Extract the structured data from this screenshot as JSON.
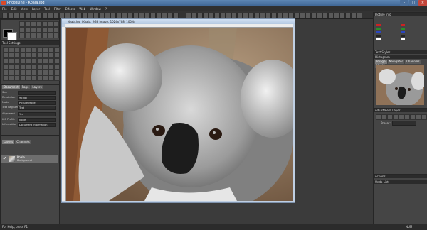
{
  "window": {
    "title": "PhotoLine - Koala.jpg"
  },
  "menu": [
    "File",
    "Edit",
    "View",
    "Layer",
    "Tool",
    "Filter",
    "Effects",
    "Web",
    "Window",
    "?"
  ],
  "panels": {
    "tool_settings": {
      "title": "Tool Settings"
    },
    "document": {
      "tabs": [
        "Document",
        "Page",
        "Layers"
      ],
      "rows": [
        {
          "label": "Size",
          "value": ""
        },
        {
          "label": "Resolution",
          "value": "96 dpi"
        },
        {
          "label": "Mode",
          "value": "Picture Mode"
        },
        {
          "label": "Text Register",
          "value": "Text"
        },
        {
          "label": "Alignment",
          "value": "Yes"
        },
        {
          "label": "ICC Profile",
          "value": "None"
        },
        {
          "label": "Information",
          "value": "Document Information"
        }
      ]
    },
    "layers": {
      "tabs": [
        "Layers",
        "Channels"
      ],
      "items": [
        {
          "name": "Koala",
          "sub": "Background"
        }
      ]
    },
    "picture_info": {
      "title": "Picture Info"
    },
    "text_styles": {
      "title": "Text Styles"
    },
    "histogram": {
      "title": "Histogram",
      "tabs": [
        "Image",
        "Navigator",
        "Channels",
        "Mask"
      ]
    },
    "adjustment_layer": {
      "title": "Adjustment Layer",
      "preset_label": "Preset:"
    },
    "actions": {
      "title": "Actions"
    },
    "undo_list": {
      "title": "Undo List"
    }
  },
  "document_window": {
    "title": "Koala.jpg (Koala, RGB Image, 1024x768, 100%)"
  },
  "status": {
    "left": "For Help, press F1",
    "right": "NUM"
  },
  "colors": {
    "window_title": "#3c6392",
    "panel_bg": "#454545",
    "canvas_bg": "#3b3b3b",
    "doc_frame": "#bfcfe3"
  }
}
